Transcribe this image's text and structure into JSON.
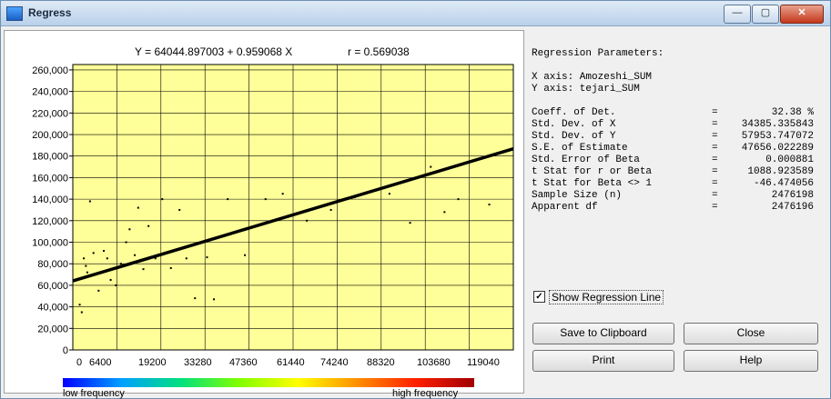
{
  "window": {
    "title": "Regress",
    "controls": {
      "minimize": "—",
      "maximize": "▢",
      "close": "✕"
    }
  },
  "equation_text": "Y = 64044.897003 + 0.959068 X",
  "r_text": "r = 0.569038",
  "chart_data": {
    "type": "scatter",
    "title": "Y = 64044.897003 + 0.959068 X",
    "y_ticks": [
      "260,000",
      "240,000",
      "220,000",
      "200,000",
      "180,000",
      "160,000",
      "140,000",
      "120,000",
      "100,000",
      "80,000",
      "60,000",
      "40,000",
      "20,000",
      "0"
    ],
    "x_ticks": [
      "0",
      "6400",
      "19200",
      "33280",
      "47360",
      "61440",
      "74240",
      "88320",
      "103680",
      "119040"
    ],
    "ylim": [
      0,
      265000
    ],
    "xlim": [
      0,
      128000
    ],
    "grid": true,
    "background_color": "#ffff99",
    "regression_line": {
      "intercept": 64044.897003,
      "slope": 0.959068,
      "color": "#000000"
    },
    "points": [
      [
        2000,
        42000
      ],
      [
        2600,
        35000
      ],
      [
        3200,
        85000
      ],
      [
        3800,
        78000
      ],
      [
        4200,
        72000
      ],
      [
        5000,
        138000
      ],
      [
        6000,
        90000
      ],
      [
        7500,
        55000
      ],
      [
        9000,
        92000
      ],
      [
        10000,
        85000
      ],
      [
        11000,
        65000
      ],
      [
        12500,
        60000
      ],
      [
        14000,
        80000
      ],
      [
        15500,
        100000
      ],
      [
        16500,
        112000
      ],
      [
        18000,
        88000
      ],
      [
        19000,
        132000
      ],
      [
        20500,
        75000
      ],
      [
        22000,
        115000
      ],
      [
        24000,
        85000
      ],
      [
        26000,
        140000
      ],
      [
        28500,
        76000
      ],
      [
        31000,
        130000
      ],
      [
        33000,
        85000
      ],
      [
        35500,
        48000
      ],
      [
        39000,
        86000
      ],
      [
        41000,
        47000
      ],
      [
        45000,
        140000
      ],
      [
        50000,
        88000
      ],
      [
        56000,
        140000
      ],
      [
        61000,
        145000
      ],
      [
        68000,
        120000
      ],
      [
        75000,
        130000
      ],
      [
        82000,
        142000
      ],
      [
        92000,
        145000
      ],
      [
        98000,
        118000
      ],
      [
        104000,
        170000
      ],
      [
        108000,
        128000
      ],
      [
        112000,
        140000
      ],
      [
        121000,
        135000
      ]
    ],
    "colorbar": {
      "low_label": "low frequency",
      "high_label": "high frequency"
    }
  },
  "parameters": {
    "heading": "Regression Parameters:",
    "x_axis": "X axis: Amozeshi_SUM",
    "y_axis": "Y axis: tejari_SUM",
    "rows": [
      {
        "label": "Coeff. of Det.",
        "eq": "=",
        "value": "32.38 %"
      },
      {
        "label": "Std. Dev. of X",
        "eq": "=",
        "value": "34385.335843"
      },
      {
        "label": "Std. Dev. of Y",
        "eq": "=",
        "value": "57953.747072"
      },
      {
        "label": "S.E. of Estimate",
        "eq": "=",
        "value": "47656.022289"
      },
      {
        "label": "Std. Error of Beta",
        "eq": "=",
        "value": "0.000881"
      },
      {
        "label": "t Stat for r or Beta",
        "eq": "=",
        "value": "1088.923589"
      },
      {
        "label": "t Stat for Beta <> 1",
        "eq": "=",
        "value": "-46.474056"
      },
      {
        "label": "Sample Size (n)",
        "eq": "=",
        "value": "2476198"
      },
      {
        "label": "Apparent df",
        "eq": "=",
        "value": "2476196"
      }
    ]
  },
  "checkbox": {
    "label": "Show Regression Line",
    "checked": true,
    "mark": "✓"
  },
  "buttons": {
    "save_clipboard": "Save to Clipboard",
    "close": "Close",
    "print": "Print",
    "help": "Help"
  }
}
